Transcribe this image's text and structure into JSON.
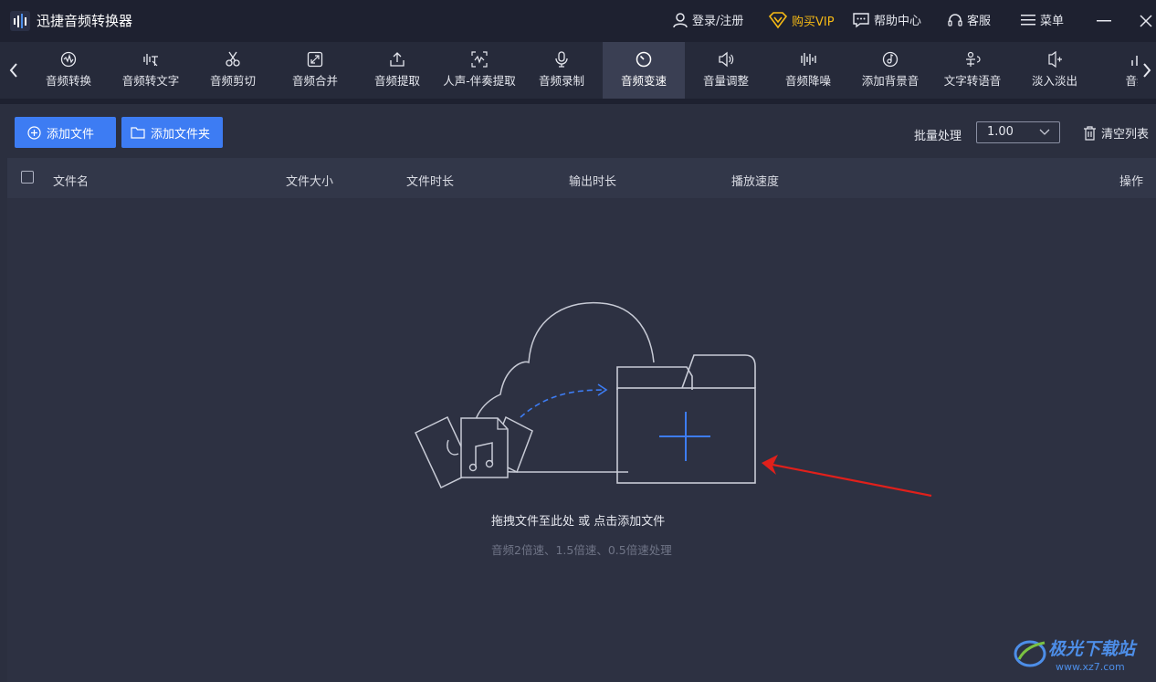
{
  "app": {
    "title": "迅捷音频转换器"
  },
  "titlebar": {
    "login_label": "登录/注册",
    "vip_label": "购买VIP",
    "help_label": "帮助中心",
    "service_label": "客服",
    "menu_label": "菜单"
  },
  "tabs": [
    {
      "label": "音频转换",
      "icon": "disc-icon"
    },
    {
      "label": "音频转文字",
      "icon": "waveform-text-icon"
    },
    {
      "label": "音频剪切",
      "icon": "scissors-icon"
    },
    {
      "label": "音频合并",
      "icon": "merge-icon"
    },
    {
      "label": "音频提取",
      "icon": "upload-icon"
    },
    {
      "label": "人声-伴奏提取",
      "icon": "voice-extract-icon"
    },
    {
      "label": "音频录制",
      "icon": "microphone-icon"
    },
    {
      "label": "音频变速",
      "icon": "speed-icon",
      "active": true
    },
    {
      "label": "音量调整",
      "icon": "speaker-icon"
    },
    {
      "label": "音频降噪",
      "icon": "noise-bars-icon"
    },
    {
      "label": "添加背景音",
      "icon": "music-disc-icon"
    },
    {
      "label": "文字转语音",
      "icon": "text-speech-icon"
    },
    {
      "label": "淡入淡出",
      "icon": "fade-icon"
    },
    {
      "label": "音频",
      "icon": "bars-icon"
    }
  ],
  "toolbar": {
    "add_file_label": "添加文件",
    "add_folder_label": "添加文件夹",
    "batch_label": "批量处理",
    "batch_value": "1.00",
    "clear_label": "清空列表"
  },
  "table": {
    "columns": [
      "文件名",
      "文件大小",
      "文件时长",
      "输出时长",
      "播放速度",
      "操作"
    ]
  },
  "empty_state": {
    "title": "拖拽文件至此处 或 点击添加文件",
    "subtitle": "音频2倍速、1.5倍速、0.5倍速处理"
  },
  "watermark": {
    "text": "极光下载站",
    "url": "www.xz7.com"
  },
  "colors": {
    "accent": "#3d7cf3",
    "vip": "#f5b915",
    "titlebar_bg": "#1e2130",
    "content_bg": "#2b2f3f",
    "annotation_arrow": "#e0201b"
  }
}
